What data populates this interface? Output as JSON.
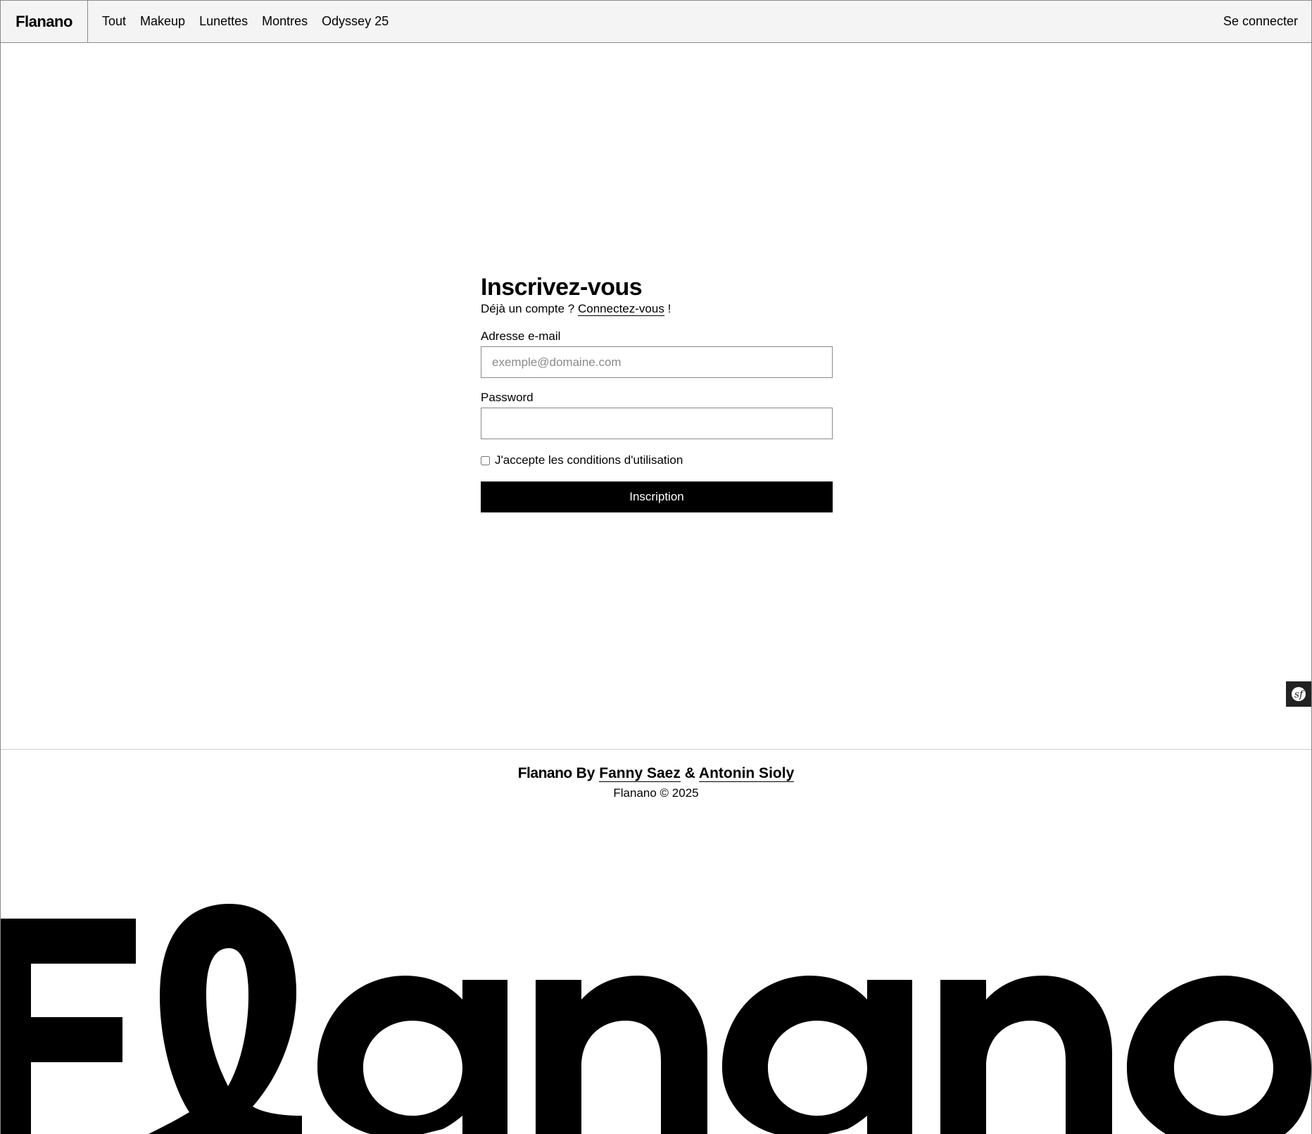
{
  "header": {
    "brand": "Flanano",
    "nav": [
      "Tout",
      "Makeup",
      "Lunettes",
      "Montres",
      "Odyssey 25"
    ],
    "login": "Se connecter"
  },
  "form": {
    "title": "Inscrivez-vous",
    "already_prefix": "Déjà un compte ?",
    "login_link": "Connectez-vous",
    "already_suffix": "!",
    "email_label": "Adresse e-mail",
    "email_placeholder": "exemple@domaine.com",
    "email_value": "",
    "password_label": "Password",
    "password_value": "",
    "terms_label": "J'accepte les conditions d'utilisation",
    "terms_checked": false,
    "submit": "Inscription"
  },
  "footer": {
    "brand": "Flanano",
    "by": "By",
    "author1": "Fanny Saez",
    "amp": "&",
    "author2": "Antonin Sioly",
    "copyright": "Flanano © 2025",
    "big_logo": "Flanano"
  },
  "icons": {
    "symfony_toolbar": "symfony-icon"
  },
  "colors": {
    "header_bg": "#f4f4f4",
    "primary": "#000000",
    "border": "#8a8a8a",
    "toolbar_bg": "#222222"
  }
}
